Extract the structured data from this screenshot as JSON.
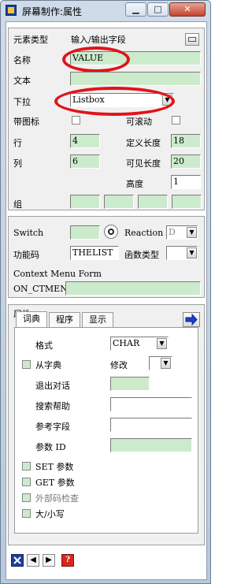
{
  "window": {
    "title": "屏幕制作:属性",
    "minimize": "▁",
    "maximize": "□",
    "close": "✕"
  },
  "attrs": {
    "element_type_label": "元素类型",
    "element_type_value": "输入/输出字段",
    "name_label": "名称",
    "name_value": "VALUE",
    "text_label": "文本",
    "text_value": "",
    "dropdown_label": "下拉",
    "dropdown_value": "Listbox",
    "with_icon_label": "带图标",
    "scrollable_label": "可滚动",
    "line_label": "行",
    "line_value": "4",
    "def_length_label": "定义长度",
    "def_length_value": "18",
    "column_label": "列",
    "column_value": "6",
    "vis_length_label": "可见长度",
    "vis_length_value": "20",
    "height_label": "高度",
    "height_value": "1",
    "group_label": "组"
  },
  "func": {
    "switch_label": "Switch",
    "reaction_label": "Reaction",
    "reaction_value": "D",
    "fcode_label": "功能码",
    "fcode_value": "THELIST",
    "ftype_label": "函数类型",
    "ftype_value": "",
    "ctx_label": "Context Menu Form",
    "ctx_prefix": "ON_CTMENU_",
    "ctx_value": ""
  },
  "props": {
    "group_title": "属性",
    "tabs": [
      "词典",
      "程序",
      "显示"
    ],
    "format_label": "格式",
    "format_value": "CHAR",
    "from_dict_label": "从字典",
    "modify_label": "修改",
    "exit_dialog_label": "退出对话",
    "search_help_label": "搜索帮助",
    "ref_field_label": "参考字段",
    "param_id_label": "参数 ID",
    "set_param_label": "SET 参数",
    "get_param_label": "GET 参数",
    "foreign_key_label": "外部码检查",
    "upper_lower_label": "大/小写"
  },
  "nav": {
    "prev": "◀",
    "next": "▶",
    "help": "?"
  },
  "colors": {
    "field_green": "#ccebcc",
    "highlight_oval": "#e0141a",
    "accent_blue": "#1d3f9a"
  }
}
